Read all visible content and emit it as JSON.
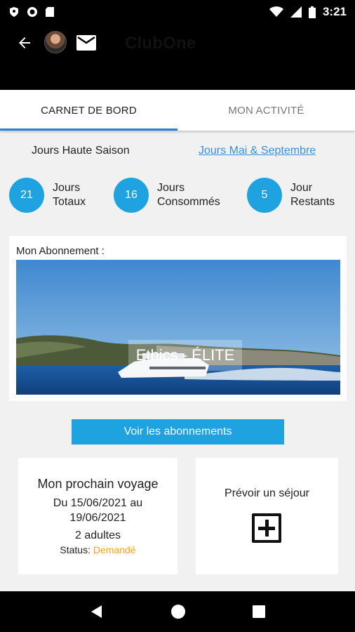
{
  "status_bar": {
    "time": "3:21"
  },
  "app_bar": {
    "title": "ClubOne"
  },
  "tabs": [
    {
      "label": "CARNET DE BORD",
      "active": true
    },
    {
      "label": "MON ACTIVITÉ",
      "active": false
    }
  ],
  "season": {
    "left_label": "Jours Haute Saison",
    "right_link": "Jours Mai & Septembre"
  },
  "stats": [
    {
      "value": "21",
      "line1": "Jours",
      "line2": "Totaux"
    },
    {
      "value": "16",
      "line1": "Jours",
      "line2": "Consommés"
    },
    {
      "value": "5",
      "line1": "Jour",
      "line2": "Restants"
    }
  ],
  "subscription": {
    "title": "Mon Abonnement :",
    "name": "Ethics - ÉLITE"
  },
  "subscriptions_button": "Voir les abonnements",
  "next_trip": {
    "title": "Mon prochain voyage",
    "dates_line1": "Du 15/06/2021 au",
    "dates_line2": "19/06/2021",
    "adults": "2 adultes",
    "status_label": "Status:",
    "status_value": "Demandé"
  },
  "plan_stay": {
    "title": "Prévoir un séjour"
  },
  "colors": {
    "accent": "#1fa3e0",
    "tab_indicator": "#2b7fd9",
    "status_pending": "#f7a11a",
    "link": "#3a8fd6"
  },
  "icons": [
    "back-arrow-icon",
    "mail-icon",
    "add-box-icon",
    "nav-back-icon",
    "nav-home-icon",
    "nav-recents-icon"
  ]
}
